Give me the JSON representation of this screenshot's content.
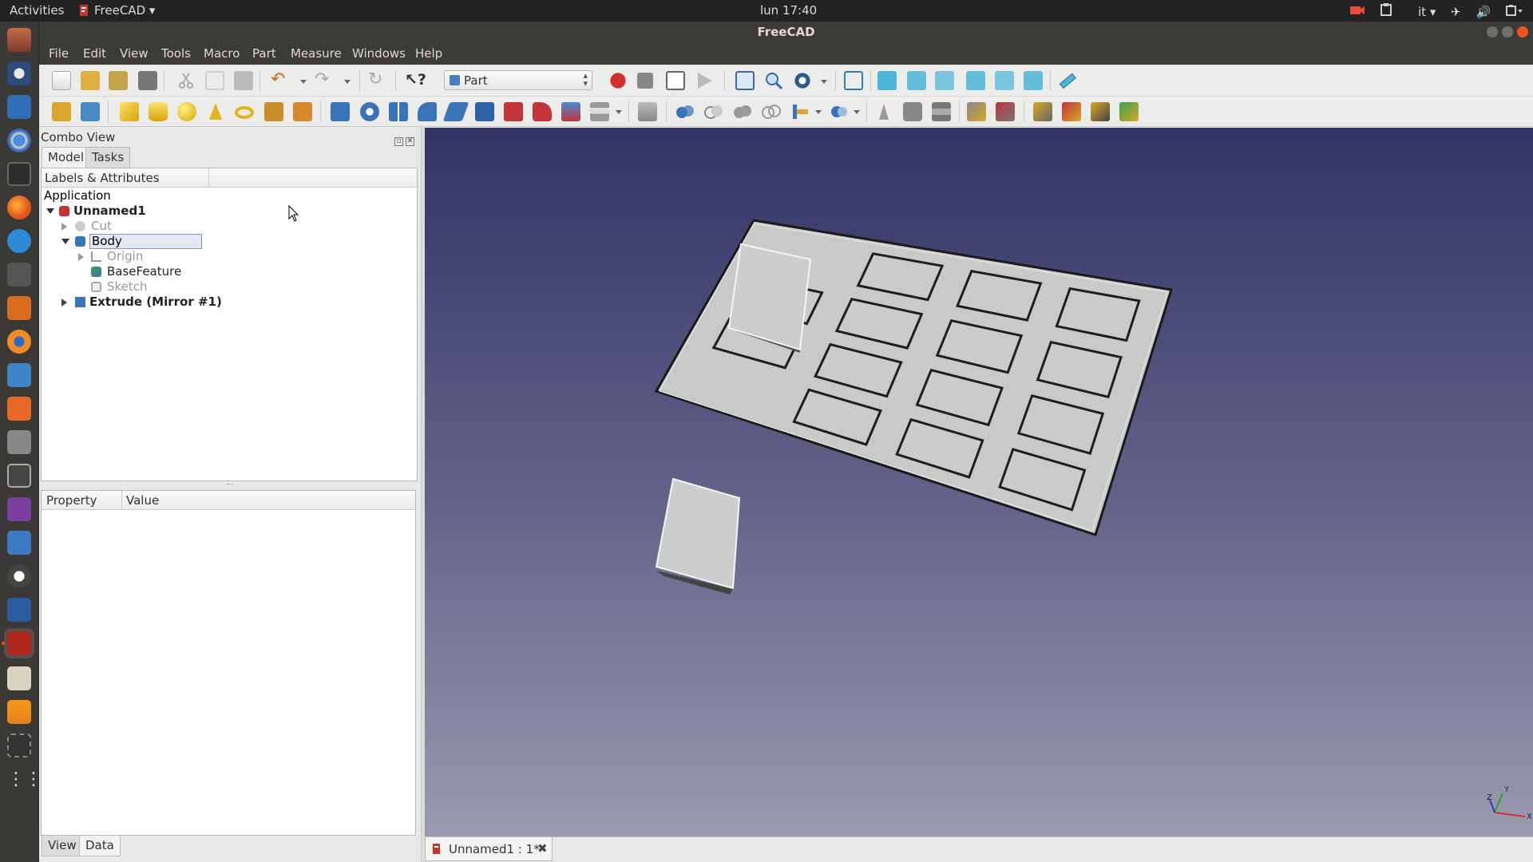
{
  "topbar": {
    "activities": "Activities",
    "app_name": "FreeCAD",
    "app_menu_arrow": "▾",
    "clock": "lun 17:40",
    "keyboard_layout": "it",
    "indicators": [
      "camera-icon",
      "clipboard-icon",
      "keyboard-layout",
      "airplane-icon",
      "volume-icon",
      "battery-icon"
    ]
  },
  "window": {
    "title": "FreeCAD"
  },
  "menubar": [
    "File",
    "Edit",
    "View",
    "Tools",
    "Macro",
    "Part",
    "Measure",
    "Windows",
    "Help"
  ],
  "workbench": {
    "selected": "Part"
  },
  "combo": {
    "title": "Combo View",
    "tabs": [
      "Model",
      "Tasks"
    ],
    "tree_header": "Labels & Attributes",
    "tree": {
      "application": "Application",
      "items": [
        {
          "label": "Unnamed1",
          "style": "bold"
        },
        {
          "label": "Cut",
          "style": "grey"
        },
        {
          "label": "Body",
          "style": "selected"
        },
        {
          "label": "Origin",
          "style": "grey"
        },
        {
          "label": "BaseFeature",
          "style": "normal"
        },
        {
          "label": "Sketch",
          "style": "grey"
        },
        {
          "label": "Extrude (Mirror #1)",
          "style": "bold"
        }
      ]
    },
    "property_headers": [
      "Property",
      "Value"
    ],
    "bottom_tabs": [
      "View",
      "Data"
    ]
  },
  "document_tab": {
    "label": "Unnamed1 : 1*",
    "close": "✖"
  },
  "axis": {
    "x": "X",
    "y": "Y",
    "z": "Z"
  },
  "colors": {
    "accent": "#e95420",
    "view_top": "#333366",
    "view_bottom": "#9a9ab0",
    "shape_face": "#cdcdcd",
    "selection": "#7e97c8"
  }
}
